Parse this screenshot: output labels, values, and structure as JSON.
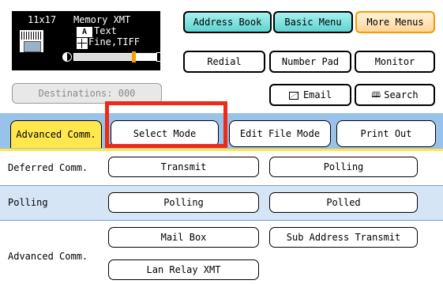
{
  "status": {
    "paper_size": "11x17",
    "mode": "Memory XMT",
    "text_icon": "A",
    "original_type": "Text",
    "resolution": "Fine,TIFF",
    "contrast_level": 0.72
  },
  "destinations_label": "Destinations: 000",
  "header_buttons": {
    "address_book": "Address Book",
    "basic_menu": "Basic Menu",
    "more_menus": "More Menus",
    "redial": "Redial",
    "number_pad": "Number Pad",
    "monitor": "Monitor",
    "email": "Email",
    "search": "Search"
  },
  "tabs": {
    "advanced_comm": "Advanced Comm.",
    "select_mode": "Select Mode",
    "edit_file_mode": "Edit File Mode",
    "print_out": "Print Out"
  },
  "rows": {
    "deferred": {
      "label": "Deferred Comm.",
      "buttons": [
        "Transmit",
        "Polling"
      ]
    },
    "polling": {
      "label": "Polling",
      "buttons": [
        "Polling",
        "Polled"
      ]
    },
    "advanced": {
      "label": "Advanced Comm.",
      "buttons": [
        "Mail Box",
        "Sub Address Transmit",
        "Lan Relay XMT"
      ]
    }
  },
  "colors": {
    "active_tab": "#ffe74d",
    "tab_strip": "#98c2ea",
    "highlight": "#ee2a16",
    "teal_button": "#5ed3d0",
    "orange_border": "#f59a00"
  },
  "icons": [
    "original-document-icon",
    "text-mode-icon",
    "resolution-grid-icon",
    "contrast-icon",
    "envelope-icon",
    "book-icon"
  ]
}
